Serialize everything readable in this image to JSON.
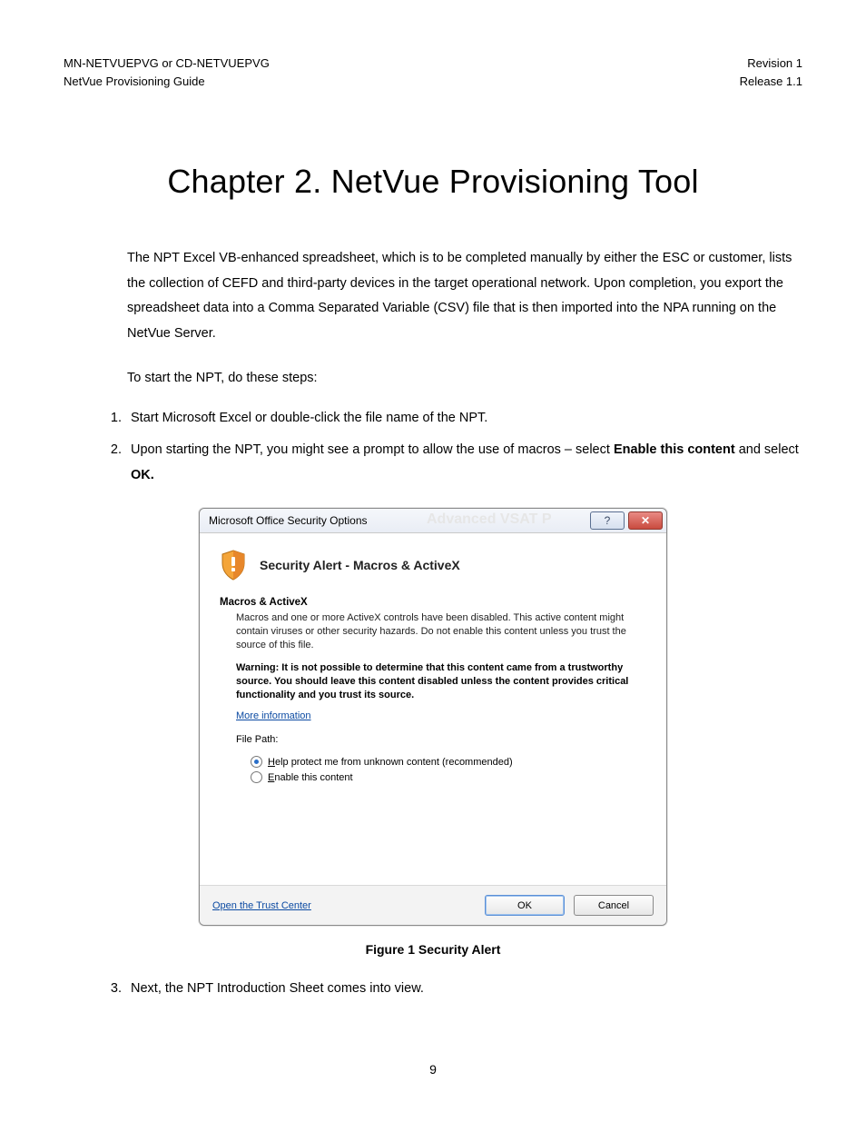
{
  "header": {
    "left_line1": "MN-NETVUEPVG or CD-NETVUEPVG",
    "left_line2": "NetVue Provisioning Guide",
    "right_line1": "Revision 1",
    "right_line2": "Release 1.1"
  },
  "chapter_title": "Chapter 2.  NetVue Provisioning Tool",
  "intro_paragraph": "The NPT Excel VB-enhanced spreadsheet, which is to be completed manually by either the ESC or customer, lists the collection of CEFD and third-party devices in the target operational network.  Upon completion, you export the spreadsheet data into a Comma Separated Variable (CSV) file that is then imported into the NPA running on the NetVue Server.",
  "start_line": "To start the NPT, do these steps:",
  "steps": {
    "s1": "Start Microsoft Excel or double-click the file name of the NPT.",
    "s2_pre": "Upon starting the NPT, you might see a prompt to allow the use of macros – select ",
    "s2_bold1": "Enable this content",
    "s2_mid": " and select ",
    "s2_bold2": "OK.",
    "s3": "Next, the NPT Introduction Sheet comes into view."
  },
  "dialog": {
    "title": "Microsoft Office Security Options",
    "ghost": "Advanced VSAT P",
    "alert_title": "Security Alert - Macros & ActiveX",
    "section_label": "Macros & ActiveX",
    "body1": "Macros and one or more ActiveX controls have been disabled. This active content might contain viruses or other security hazards. Do not enable this content unless you trust the source of this file.",
    "warn": "Warning: It is not possible to determine that this content came from a trustworthy source. You should leave this content disabled unless the content provides critical functionality and you trust its source.",
    "more_info": "More information",
    "file_path_label": "File Path:",
    "radio1_prefix": "H",
    "radio1_rest": "elp protect me from unknown content (recommended)",
    "radio2_prefix": "E",
    "radio2_rest": "nable this content",
    "trust_center": "Open the Trust Center",
    "ok": "OK",
    "cancel": "Cancel",
    "help_glyph": "?",
    "close_glyph": "✕"
  },
  "figure_caption": "Figure 1 Security Alert",
  "page_number": "9"
}
